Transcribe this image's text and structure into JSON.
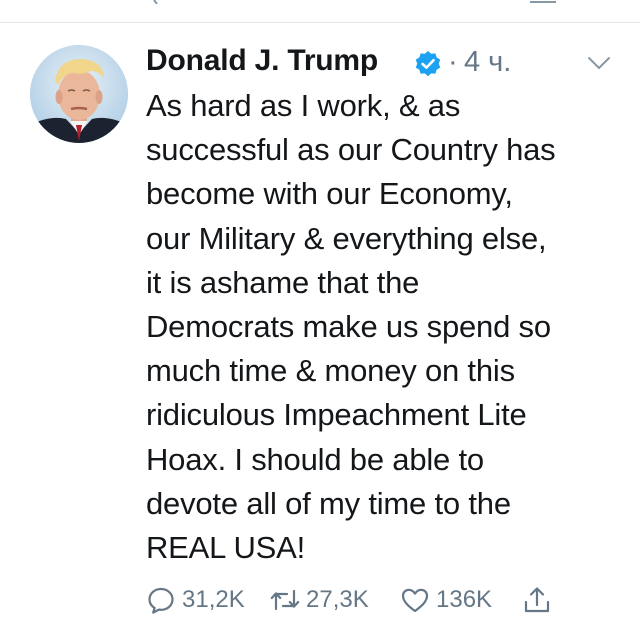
{
  "tweet": {
    "author": {
      "display_name": "Donald J. Trump",
      "verified": true,
      "avatar_icon": "profile-photo"
    },
    "separator": "·",
    "timestamp": "4 ч.",
    "text": "As hard as I work, & as\nsuccessful as our Country has\nbecome with our Economy,\nour Military & everything else,\nit is ashame that the\nDemocrats make us spend so\nmuch time & money on this\nridiculous Impeachment Lite\nHoax. I should be able to\ndevote all of my time to the\nREAL USA!",
    "actions": {
      "reply_count": "31,2K",
      "retweet_count": "27,3K",
      "like_count": "136K"
    }
  },
  "colors": {
    "text": "#14171a",
    "secondary_text": "#657786",
    "verified_badge": "#1da1f2",
    "divider": "#e1e8ed",
    "icon_gray": "#657786"
  },
  "icons": [
    "verified-badge-icon",
    "caret-down-icon",
    "reply-icon",
    "retweet-icon",
    "like-icon",
    "share-icon"
  ]
}
